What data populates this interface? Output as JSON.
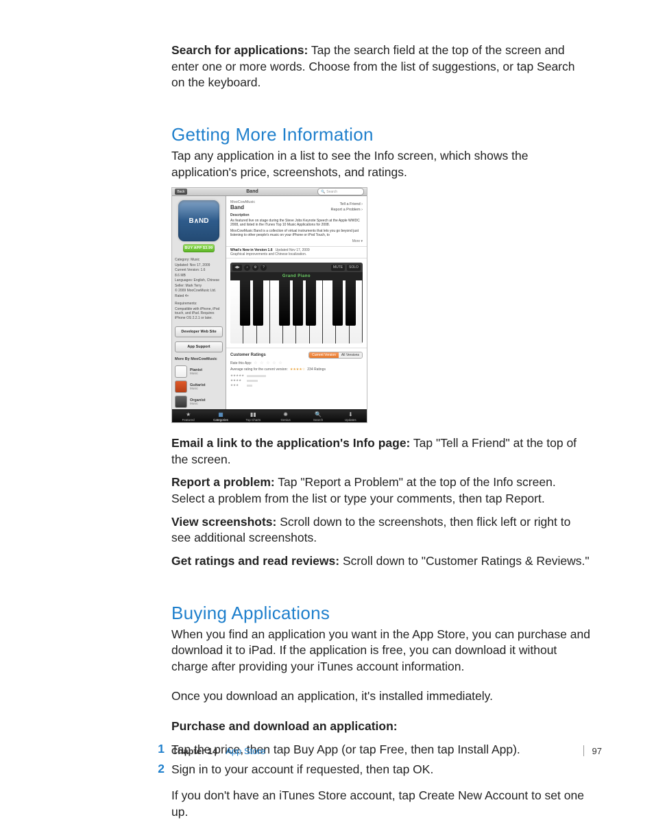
{
  "intro": {
    "bold": "Search for applications:",
    "p1_cont": " Tap the search field at the top of the screen and enter one or more words. Choose from the list of suggestions, or tap Search on the keyboard."
  },
  "section1": {
    "title": "Getting More Information",
    "p1": "Tap any application in a list to see the Info screen, which shows the application's price, screenshots, and ratings.",
    "email_bold": "Email a link to the application's Info page:",
    "email_txt": " Tap \"Tell a Friend\" at the top of the screen.",
    "report_bold": "Report a problem:",
    "report_txt": " Tap \"Report a Problem\" at the top of the Info screen. Select a problem from the list or type your comments, then tap Report.",
    "view_bold": "View screenshots:",
    "view_txt": " Scroll down to the screenshots, then flick left or right to see additional screenshots.",
    "ratings_bold": "Get ratings and read reviews:",
    "ratings_txt": " Scroll down to \"Customer Ratings & Reviews.\""
  },
  "section2": {
    "title": "Buying Applications",
    "p1": "When you find an application you want in the App Store, you can purchase and download it to iPad. If the application is free, you can download it without charge after providing your iTunes account information.",
    "p2": "Once you download an application, it's installed immediately.",
    "task_bold": "Purchase and download an application:",
    "step1_n": "1",
    "step1": "Tap the price, then tap Buy App (or tap Free, then tap Install App).",
    "step2_n": "2",
    "step2": "Sign in to your account if requested, then tap OK.",
    "after": "If you don't have an iTunes Store account, tap Create New Account to set one up."
  },
  "screenshot": {
    "back": "Back",
    "navtitle": "Band",
    "search_ph": "Search",
    "buy": "BUY APP $3.99",
    "vendor": "MooCowMusic",
    "appname": "Band",
    "tell": "Tell a Friend ›",
    "report": "Report a Problem ›",
    "desc_title": "Description",
    "desc_l1": "As featured live on stage during the Steve Jobs Keynote Speech at the Apple WWDC 2008, and listed in the iTunes Top 10 Music Applications for 2008.",
    "desc_l2": "MooCowMusic Band is a collection of virtual instruments that lets you go beyond just listening to other people's music on your iPhone or iPod Touch, to",
    "more": "More ▾",
    "whats": "What's New in Version 1.6",
    "whats_date": "Updated Nov 17, 2009",
    "whats_line": "Graphical improvements and Chinese localization.",
    "meta_cat": "Category: Music",
    "meta_upd": "Updated: Nov 17, 2009",
    "meta_ver": "Current Version: 1.6",
    "meta_size": "8.6 MB",
    "meta_lang": "Languages: English, Chinese",
    "meta_seller": "Seller: Mark Terry",
    "meta_copy": "© 2009 MooCowMusic Ltd.",
    "meta_rated": "Rated 4+",
    "meta_req_t": "Requirements:",
    "meta_req": "Compatible with iPhone, iPod touch, and iPad. Requires iPhone OS 2.2.1 or later.",
    "dev_site": "Developer Web Site",
    "app_support": "App Support",
    "more_by": "More By MooCowMusic",
    "rel1": "Pianist",
    "rel1s": "Music",
    "rel2": "Guitarist",
    "rel2s": "Music",
    "rel3": "Organist",
    "rel3s": "Music",
    "piano_label": "Grand Piano",
    "ratings_t": "Customer Ratings",
    "seg_cur": "Current Version",
    "seg_all": "All Versions",
    "rate_this": "Rate this App:",
    "avg_line": "Average rating for the current version:",
    "avg_count": "234 Ratings",
    "tab1": "Featured",
    "tab2": "Categories",
    "tab3": "Top Charts",
    "tab4": "Genius",
    "tab5": "Search",
    "tab6": "Updates"
  },
  "footer": {
    "chapter_pre": "Chapter 14",
    "chapter_name": "App Store",
    "page_no": "97"
  }
}
